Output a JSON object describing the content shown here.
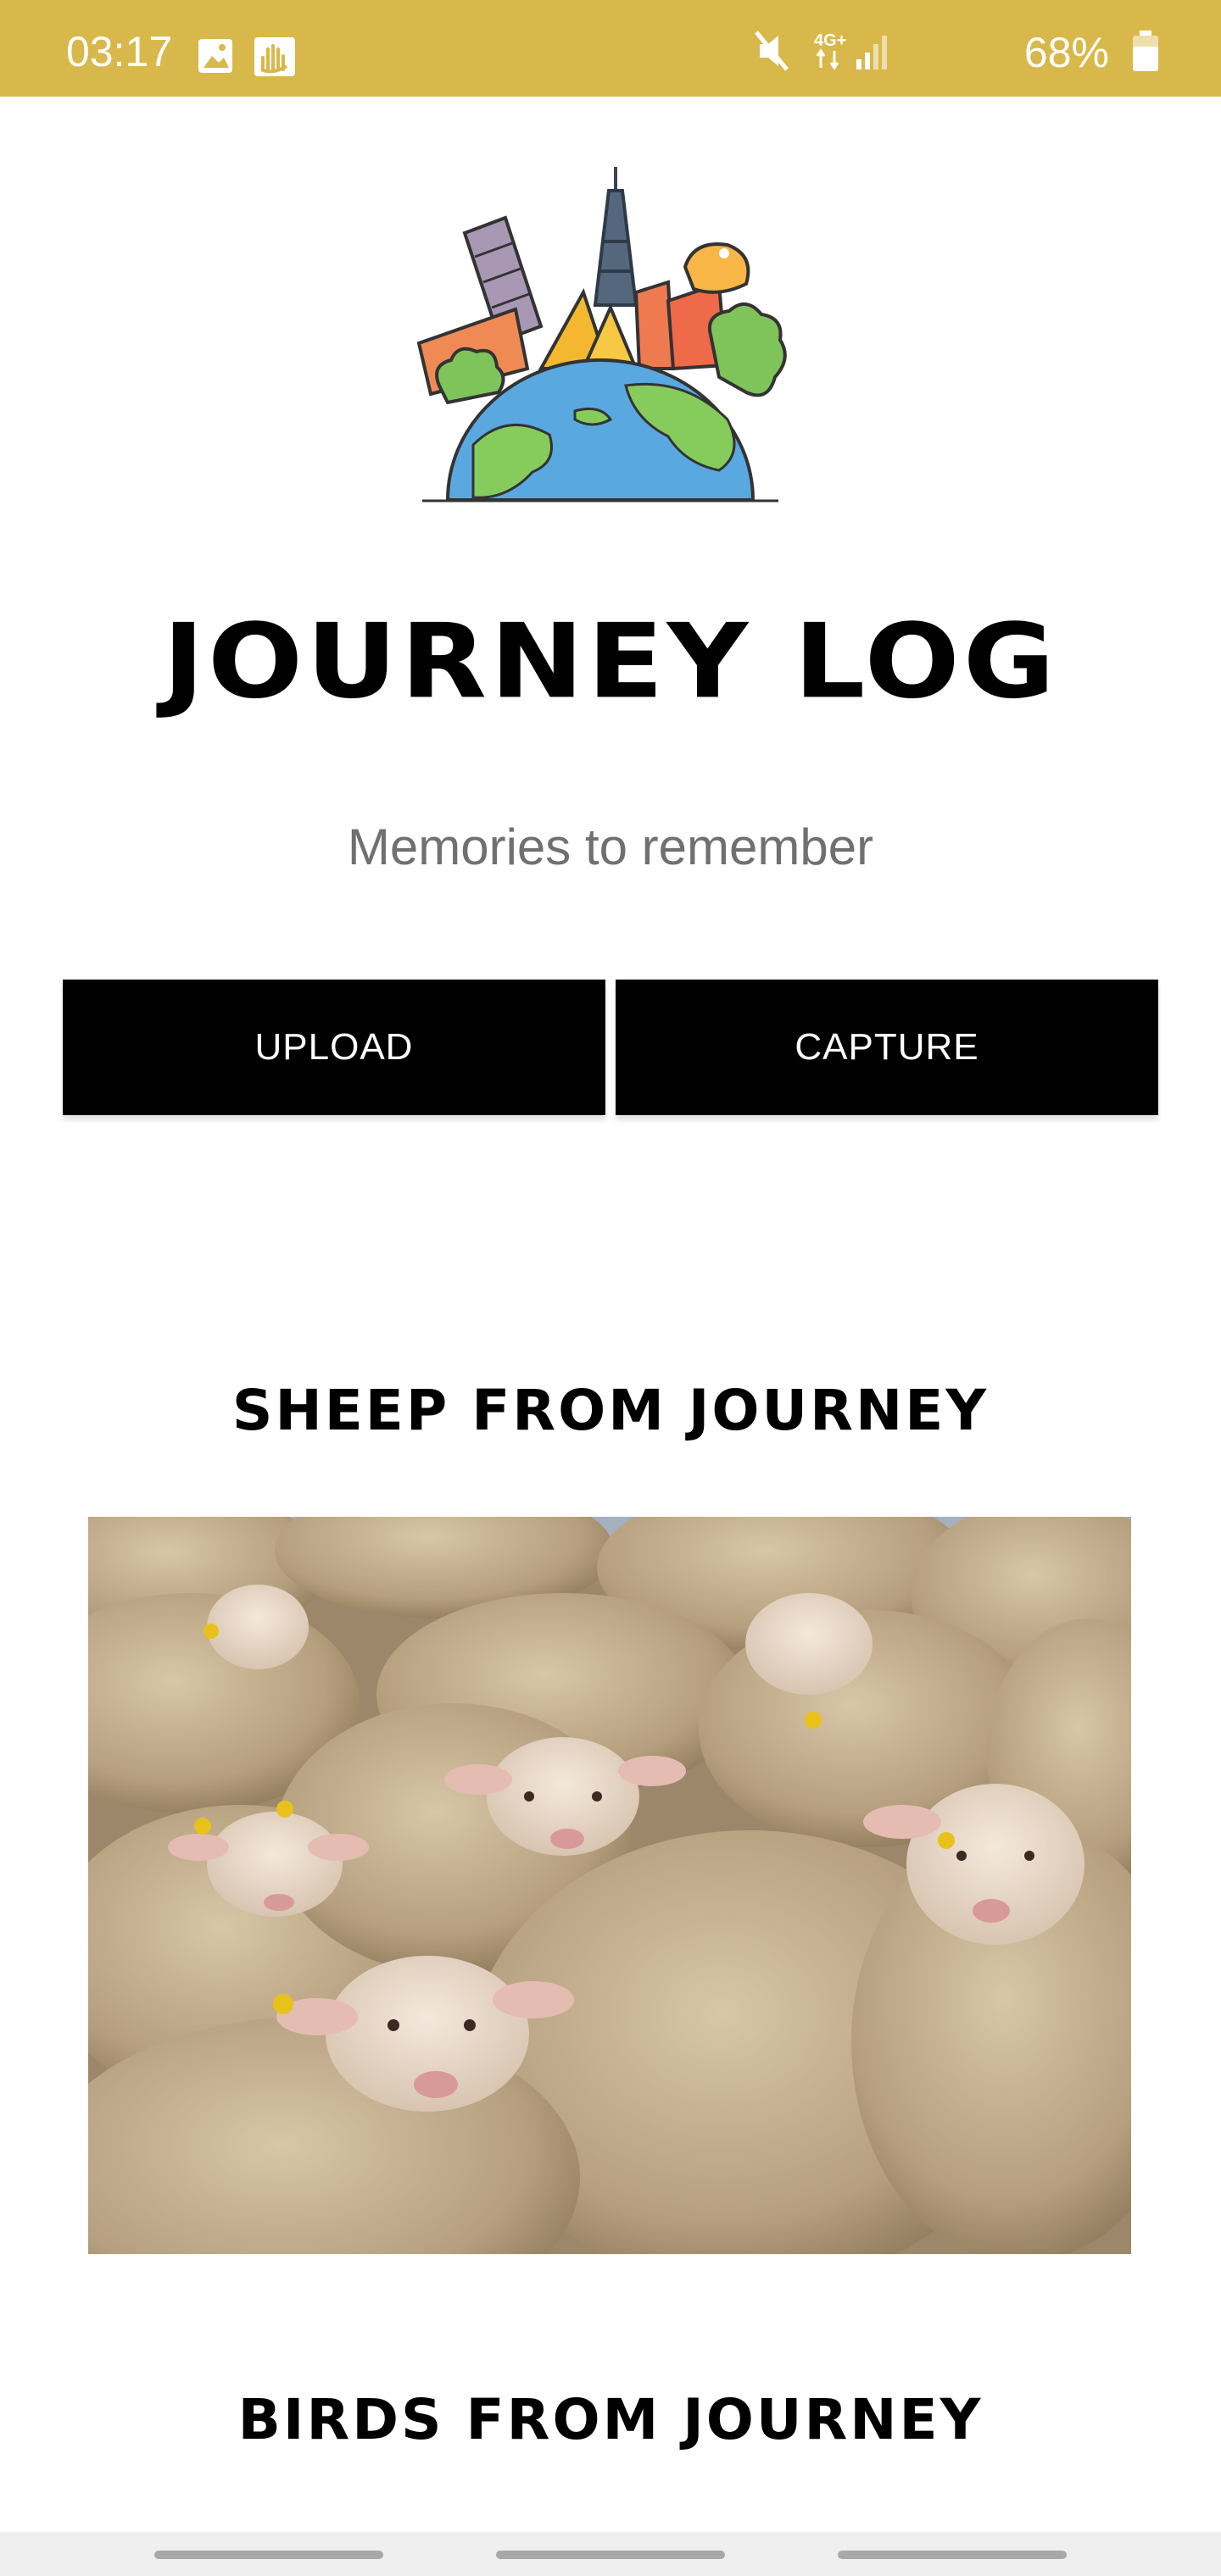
{
  "status_bar": {
    "time": "03:17",
    "network": "4G+",
    "battery": "68%",
    "color": "#d8b84a",
    "icons": [
      "image-icon",
      "hand-notification-icon",
      "mute-icon",
      "network-4g-icon",
      "signal-icon",
      "battery-icon"
    ]
  },
  "header": {
    "logo": "travel-landmarks-globe-logo",
    "title": "JOURNEY LOG",
    "subtitle": "Memories to remember"
  },
  "actions": {
    "upload_label": "UPLOAD",
    "capture_label": "CAPTURE"
  },
  "sections": [
    {
      "heading": "SHEEP FROM JOURNEY",
      "image": "sheep-flock-photo"
    },
    {
      "heading": "BIRDS FROM JOURNEY"
    }
  ]
}
